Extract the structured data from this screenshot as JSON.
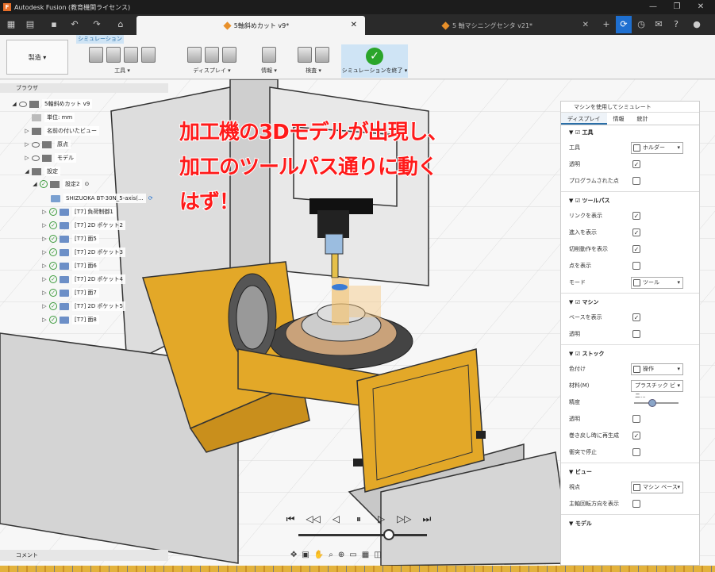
{
  "app": {
    "title": "Autodesk Fusion (教育機関ライセンス)",
    "logo_letter": "F"
  },
  "tabs": [
    {
      "label": "5軸斜めカット v9*",
      "active": true
    },
    {
      "label": "5 軸マシニングセンタ v21*",
      "active": false
    }
  ],
  "toolbar": {
    "mode": "製造 ▾",
    "sim_tab": "シミュレーション",
    "groups": {
      "tools": "工具 ▾",
      "display": "ディスプレイ ▾",
      "info": "情報 ▾",
      "inspect": "検査 ▾",
      "finish": "シミュレーションを終了 ▾"
    }
  },
  "browser": {
    "title": "ブラウザ",
    "items": [
      {
        "label": "5軸斜めカット v9"
      },
      {
        "label": "単位: mm"
      },
      {
        "label": "名前の付いたビュー"
      },
      {
        "label": "原点"
      },
      {
        "label": "モデル"
      },
      {
        "label": "設定"
      },
      {
        "label": "設定2"
      },
      {
        "label": "SHIZUOKA BT-30N_5-axis(..."
      },
      {
        "label": "[T7] 負荷制御1"
      },
      {
        "label": "[T7] 2D ポケット2"
      },
      {
        "label": "[T7] 面5"
      },
      {
        "label": "[T7] 2D ポケット3"
      },
      {
        "label": "[T7] 面6"
      },
      {
        "label": "[T7] 2D ポケット4"
      },
      {
        "label": "[T7] 面7"
      },
      {
        "label": "[T7] 2D ポケット5"
      },
      {
        "label": "[T7] 面8"
      }
    ]
  },
  "overlay_text": {
    "line1": "加工機の3Dモデルが出現し、",
    "line2": "加工のツールパス通りに動く",
    "line3": "はず！"
  },
  "panel": {
    "title": "マシンを使用してシミュレート",
    "tabs": [
      "ディスプレイ",
      "情報",
      "統計"
    ],
    "sections": {
      "tool": {
        "title": "工具",
        "tool_label": "工具",
        "tool_value": "ホルダー",
        "transparent": "透明",
        "programmed": "プログラムされた点"
      },
      "toolpath": {
        "title": "ツールパス",
        "links": "リンクを表示",
        "approach": "進入を表示",
        "cutting": "切削動作を表示",
        "points": "点を表示",
        "mode": "モード",
        "mode_value": "ツール"
      },
      "machine": {
        "title": "マシン",
        "base": "ベースを表示",
        "transparent": "透明"
      },
      "stock": {
        "title": "ストック",
        "color": "色付け",
        "color_value": "操作",
        "material": "材料(M)",
        "material_value": "プラスチック ビニ...",
        "accuracy": "精度",
        "transparent": "透明",
        "regen": "巻き戻し時に再生成",
        "stop": "衝突で停止"
      },
      "view": {
        "title": "ビュー",
        "viewpoint": "視点",
        "viewpoint_value": "マシン ベース",
        "spindle": "主軸回転方向を表示"
      },
      "model": {
        "title": "モデル"
      }
    }
  },
  "comment": "コメント",
  "colors": {
    "accent": "#2a6fa8",
    "machine_body": "#e3a828",
    "overlay": "#ff1a1a"
  }
}
